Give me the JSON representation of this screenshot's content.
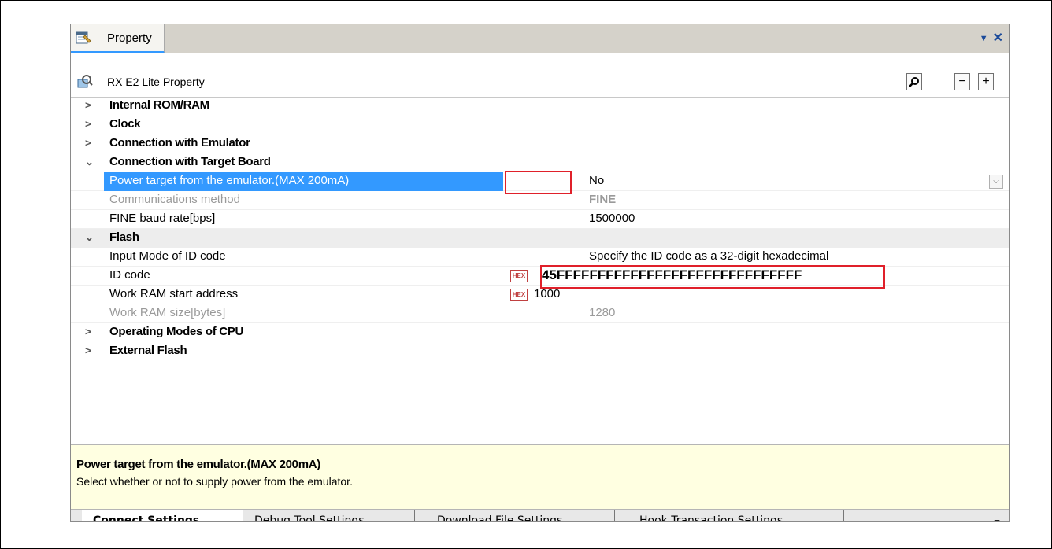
{
  "window": {
    "tab_title": "Property",
    "menu_arrow": "▼",
    "close": "✕"
  },
  "header": {
    "title": "RX E2 Lite Property",
    "search": "⌕",
    "collapse": "−",
    "expand": "+"
  },
  "categories": {
    "internal_rom": "Internal ROM/RAM",
    "clock": "Clock",
    "connection_emulator": "Connection with Emulator",
    "connection_target": "Connection with Target Board",
    "flash": "Flash",
    "operating_modes": "Operating Modes of CPU",
    "external_flash": "External Flash"
  },
  "target_props": {
    "power": {
      "name": "Power target from the emulator.(MAX 200mA)",
      "value": "No"
    },
    "comm": {
      "name": "Communications method",
      "value": "FINE"
    },
    "baud": {
      "name": "FINE baud rate[bps]",
      "value": "1500000"
    }
  },
  "flash_props": {
    "input_mode": {
      "name": "Input Mode of ID code",
      "value": "Specify the ID code as a 32-digit hexadecimal"
    },
    "id_code": {
      "name": "ID code",
      "value": "45FFFFFFFFFFFFFFFFFFFFFFFFFFFFFF",
      "badge": "HEX"
    },
    "work_ram_start": {
      "name": "Work RAM start address",
      "value": "1000",
      "badge": "HEX"
    },
    "work_ram_size": {
      "name": "Work RAM size[bytes]",
      "value": "1280"
    }
  },
  "description": {
    "title": "Power target from the emulator.(MAX 200mA)",
    "text": "Select whether or not to supply power from the emulator."
  },
  "tabs": [
    {
      "label": "Connect Settings"
    },
    {
      "label": "Debug Tool Settings"
    },
    {
      "label": "Download File Settings"
    },
    {
      "label": "Hook Transaction Settings"
    }
  ],
  "colors": {
    "selection": "#3399ff",
    "highlight_box": "#e0202a",
    "description_bg": "#ffffe1"
  }
}
